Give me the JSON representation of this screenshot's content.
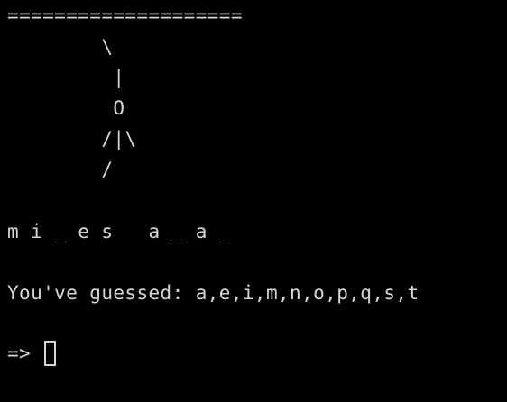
{
  "colors": {
    "background": "#000000",
    "text": "#d6d6d6"
  },
  "gallows": {
    "top_bar": "====================",
    "rows": [
      "        \\",
      "         |",
      "         O",
      "        /|\\",
      "        /"
    ]
  },
  "word_display": "m i _ e s   a _ a _",
  "guessed_line": "You've guessed: a,e,i,m,n,o,p,q,s,t",
  "prompt": {
    "symbol": "=> ",
    "input_value": ""
  },
  "icons": {
    "cursor": "block-cursor-icon"
  }
}
